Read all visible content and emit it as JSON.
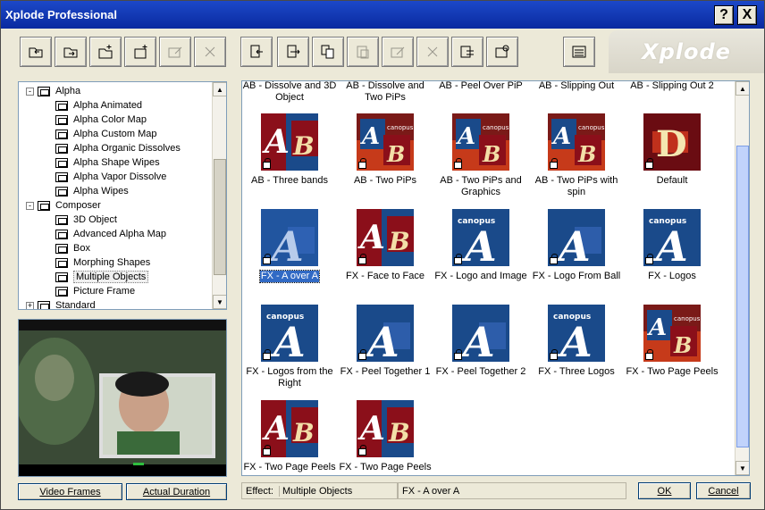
{
  "window": {
    "title": "Xplode Professional",
    "brand": "Xplode"
  },
  "title_buttons": {
    "help": "?",
    "close": "X"
  },
  "toolbar": {
    "left": [
      {
        "name": "open-folder",
        "disabled": false
      },
      {
        "name": "save-folder",
        "disabled": false
      },
      {
        "name": "new-folder",
        "disabled": false
      },
      {
        "name": "add-item",
        "disabled": false
      },
      {
        "name": "edit-item",
        "disabled": true
      },
      {
        "name": "delete-item",
        "disabled": true
      }
    ],
    "right": [
      {
        "name": "import",
        "disabled": false
      },
      {
        "name": "export",
        "disabled": false
      },
      {
        "name": "copy",
        "disabled": false
      },
      {
        "name": "paste",
        "disabled": true
      },
      {
        "name": "rename",
        "disabled": true
      },
      {
        "name": "remove",
        "disabled": true
      },
      {
        "name": "properties",
        "disabled": false
      },
      {
        "name": "settings",
        "disabled": false
      }
    ],
    "extra": {
      "name": "list-view"
    }
  },
  "tree": [
    {
      "label": "Alpha",
      "level": 0,
      "expander": "-"
    },
    {
      "label": "Alpha Animated",
      "level": 1
    },
    {
      "label": "Alpha Color Map",
      "level": 1
    },
    {
      "label": "Alpha Custom Map",
      "level": 1
    },
    {
      "label": "Alpha Organic Dissolves",
      "level": 1
    },
    {
      "label": "Alpha Shape Wipes",
      "level": 1
    },
    {
      "label": "Alpha Vapor Dissolve",
      "level": 1
    },
    {
      "label": "Alpha Wipes",
      "level": 1
    },
    {
      "label": "Composer",
      "level": 0,
      "expander": "-"
    },
    {
      "label": "3D Object",
      "level": 1
    },
    {
      "label": "Advanced Alpha Map",
      "level": 1
    },
    {
      "label": "Box",
      "level": 1
    },
    {
      "label": "Morphing Shapes",
      "level": 1
    },
    {
      "label": "Multiple Objects",
      "level": 1,
      "selected": true
    },
    {
      "label": "Picture Frame",
      "level": 1
    },
    {
      "label": "Standard",
      "level": 0,
      "expander": "+"
    }
  ],
  "preview_buttons": {
    "video_frames": "Video Frames",
    "actual_duration": "Actual Duration"
  },
  "grid_top_labels": [
    "AB - Dissolve and 3D Object",
    "AB - Dissolve and Two PiPs",
    "AB - Peel Over PiP",
    "AB - Slipping Out",
    "AB - Slipping Out 2"
  ],
  "grid": [
    {
      "label": "AB - Three bands",
      "thumb": "ab"
    },
    {
      "label": "AB - Two PiPs",
      "thumb": "canopus"
    },
    {
      "label": "AB - Two PiPs and Graphics",
      "thumb": "canopus"
    },
    {
      "label": "AB - Two PiPs with spin",
      "thumb": "canopus"
    },
    {
      "label": "Default",
      "thumb": "default"
    },
    {
      "label": "FX - A over A",
      "thumb": "a-blue",
      "selected": true
    },
    {
      "label": "FX - Face to Face",
      "thumb": "ab"
    },
    {
      "label": "FX - Logo and Image",
      "thumb": "canopus-a"
    },
    {
      "label": "FX - Logo From Ball",
      "thumb": "a-blue"
    },
    {
      "label": "FX - Logos",
      "thumb": "canopus-a"
    },
    {
      "label": "FX - Logos from the Right",
      "thumb": "canopus-a"
    },
    {
      "label": "FX - Peel Together 1",
      "thumb": "a-blue"
    },
    {
      "label": "FX - Peel Together 2",
      "thumb": "a-blue"
    },
    {
      "label": "FX - Three Logos",
      "thumb": "canopus-a"
    },
    {
      "label": "FX - Two Page Peels",
      "thumb": "canopus"
    },
    {
      "label": "FX - Two Page Peels",
      "thumb": "ab"
    },
    {
      "label": "FX - Two Page Peels",
      "thumb": "ab"
    }
  ],
  "thumb_text": {
    "canopus": "canopus",
    "letter_a": "A",
    "letter_b": "B",
    "letter_d": "D"
  },
  "status": {
    "effect_label": "Effect:",
    "effect_value": "Multiple Objects",
    "selection": "FX - A over A"
  },
  "dialog_buttons": {
    "ok": "OK",
    "cancel": "Cancel"
  },
  "colors": {
    "title_bar": "#0a2aa0",
    "selection": "#316ac5",
    "thumb_blue": "#1a4a8a",
    "thumb_red": "#8b0f1a"
  }
}
